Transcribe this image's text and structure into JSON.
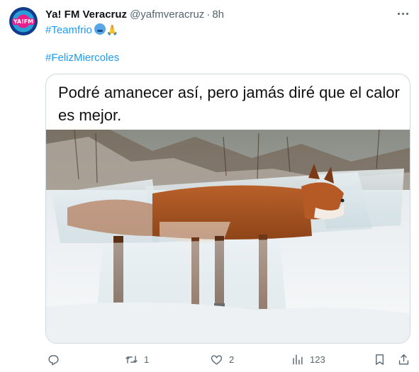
{
  "tweet": {
    "display_name": "Ya! FM Veracruz",
    "handle": "@yafmveracruz",
    "separator": "·",
    "time": "8h",
    "avatar_label": "YA!FM",
    "hashtag_1": "#Teamfrio",
    "hashtag_2": "#FelizMiercoles",
    "media": {
      "caption": "Podré amanecer así, pero jamás diré que el calor es mejor.",
      "image_subject": "fox frozen inside a block of ice in the snow"
    }
  },
  "actions": {
    "reply": {
      "icon": "reply-icon",
      "count": ""
    },
    "retweet": {
      "icon": "retweet-icon",
      "count": "1"
    },
    "like": {
      "icon": "heart-icon",
      "count": "2"
    },
    "views": {
      "icon": "views-icon",
      "count": "123"
    },
    "bookmark": {
      "icon": "bookmark-icon"
    },
    "share": {
      "icon": "share-icon"
    }
  },
  "colors": {
    "accent": "#1d9bf0",
    "secondary_text": "#536471",
    "border": "#cfd9de"
  }
}
